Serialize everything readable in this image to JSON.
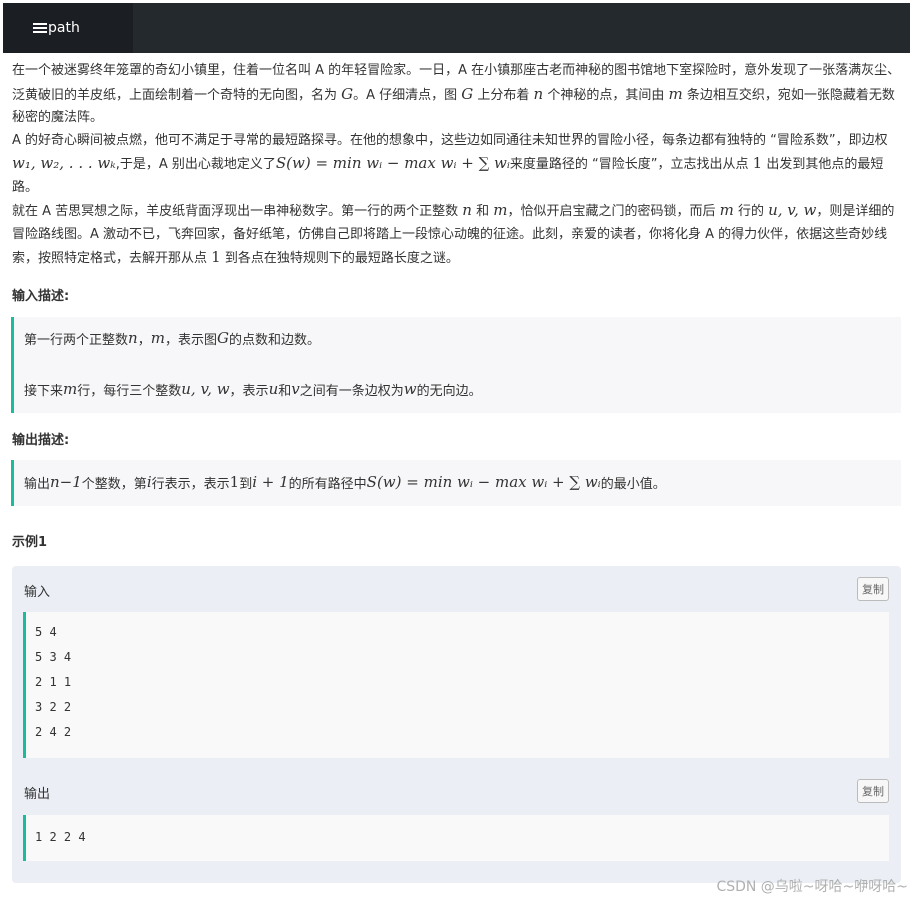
{
  "tab": {
    "label": "path"
  },
  "desc": {
    "p1_a": "在一个被迷雾终年笼罩的奇幻小镇里，住着一位名叫 A 的年轻冒险家。一日，A 在小镇那座古老而神秘的图书馆地下室探险时，意外发现了一张落满灰尘、泛黄破旧的羊皮纸，上面绘制着一个奇特的无向图，名为 ",
    "p1_G": "G",
    "p1_b": "。A 仔细清点，图 ",
    "p1_c": " 上分布着 ",
    "p1_n": "n",
    "p1_d": " 个神秘的点，其间由 ",
    "p1_m": "m",
    "p1_e": " 条边相互交织，宛如一张隐藏着无数秘密的魔法阵。",
    "p2_a": "A 的好奇心瞬间被点燃，他可不满足于寻常的最短路探寻。在他的想象中，这些边如同通往未知世界的冒险小径，每条边都有独特的 “冒险系数”，即边权 ",
    "p2_w": "w₁, w₂, . . . wₖ",
    "p2_b": ",于是，A 别出心裁地定义了",
    "p2_S": "S(w) = min wᵢ − max wᵢ + ∑ wᵢ",
    "p2_c": "来度量路径的 “冒险长度”，立志找出从点 ",
    "p2_one": "1",
    "p2_d": " 出发到其他点的最短路。",
    "p3_a": "就在 A 苦思冥想之际，羊皮纸背面浮现出一串神秘数字。第一行的两个正整数 ",
    "p3_n": "n",
    "p3_b": " 和 ",
    "p3_m": "m",
    "p3_c": "，恰似开启宝藏之门的密码锁，而后 ",
    "p3_d": " 行的 ",
    "p3_uvw": "u, v, w",
    "p3_e": "，则是详细的冒险路线图。A 激动不已，飞奔回家，备好纸笔，仿佛自己即将踏上一段惊心动魄的征途。此刻，亲爱的读者，你将化身 A 的得力伙伴，依据这些奇妙线索，按照特定格式，去解开那从点 ",
    "p3_one": "1",
    "p3_f": " 到各点在独特规则下的最短路长度之谜。"
  },
  "input_section": {
    "title": "输入描述:",
    "l1_a": "第一行两个正整数 ",
    "l1_n": "n",
    "l1_b": "，",
    "l1_m": "m",
    "l1_c": "，表示图 ",
    "l1_G": "G",
    "l1_d": " 的点数和边数。",
    "l2_a": "接下来 ",
    "l2_m": "m",
    "l2_b": " 行，每行三个整数 ",
    "l2_uvw": "u, v, w",
    "l2_c": "，表示 ",
    "l2_u": "u",
    "l2_d": " 和 ",
    "l2_v": "v",
    "l2_e": " 之间有一条边权为 ",
    "l2_w": "w",
    "l2_f": " 的无向边。"
  },
  "output_section": {
    "title": "输出描述:",
    "a": "输出 ",
    "n1": "n−1",
    "b": " 个整数，第 ",
    "i": "i",
    "c": " 行表示，表示 ",
    "one": "1",
    "d": " 到 ",
    "i1": "i + 1",
    "e": " 的所有路径中 ",
    "S": "S(w) = min wᵢ − max wᵢ + ∑ wᵢ",
    "f": " 的最小值。"
  },
  "example": {
    "title": "示例1",
    "input_label": "输入",
    "output_label": "输出",
    "copy_label": "复制",
    "input_lines": [
      "5 4",
      "5 3 4",
      "2 1 1",
      "3 2 2",
      "2 4 2"
    ],
    "output_lines": [
      "1 2 2 4"
    ]
  },
  "watermark": "CSDN @乌啦~呀哈~咿呀哈~"
}
